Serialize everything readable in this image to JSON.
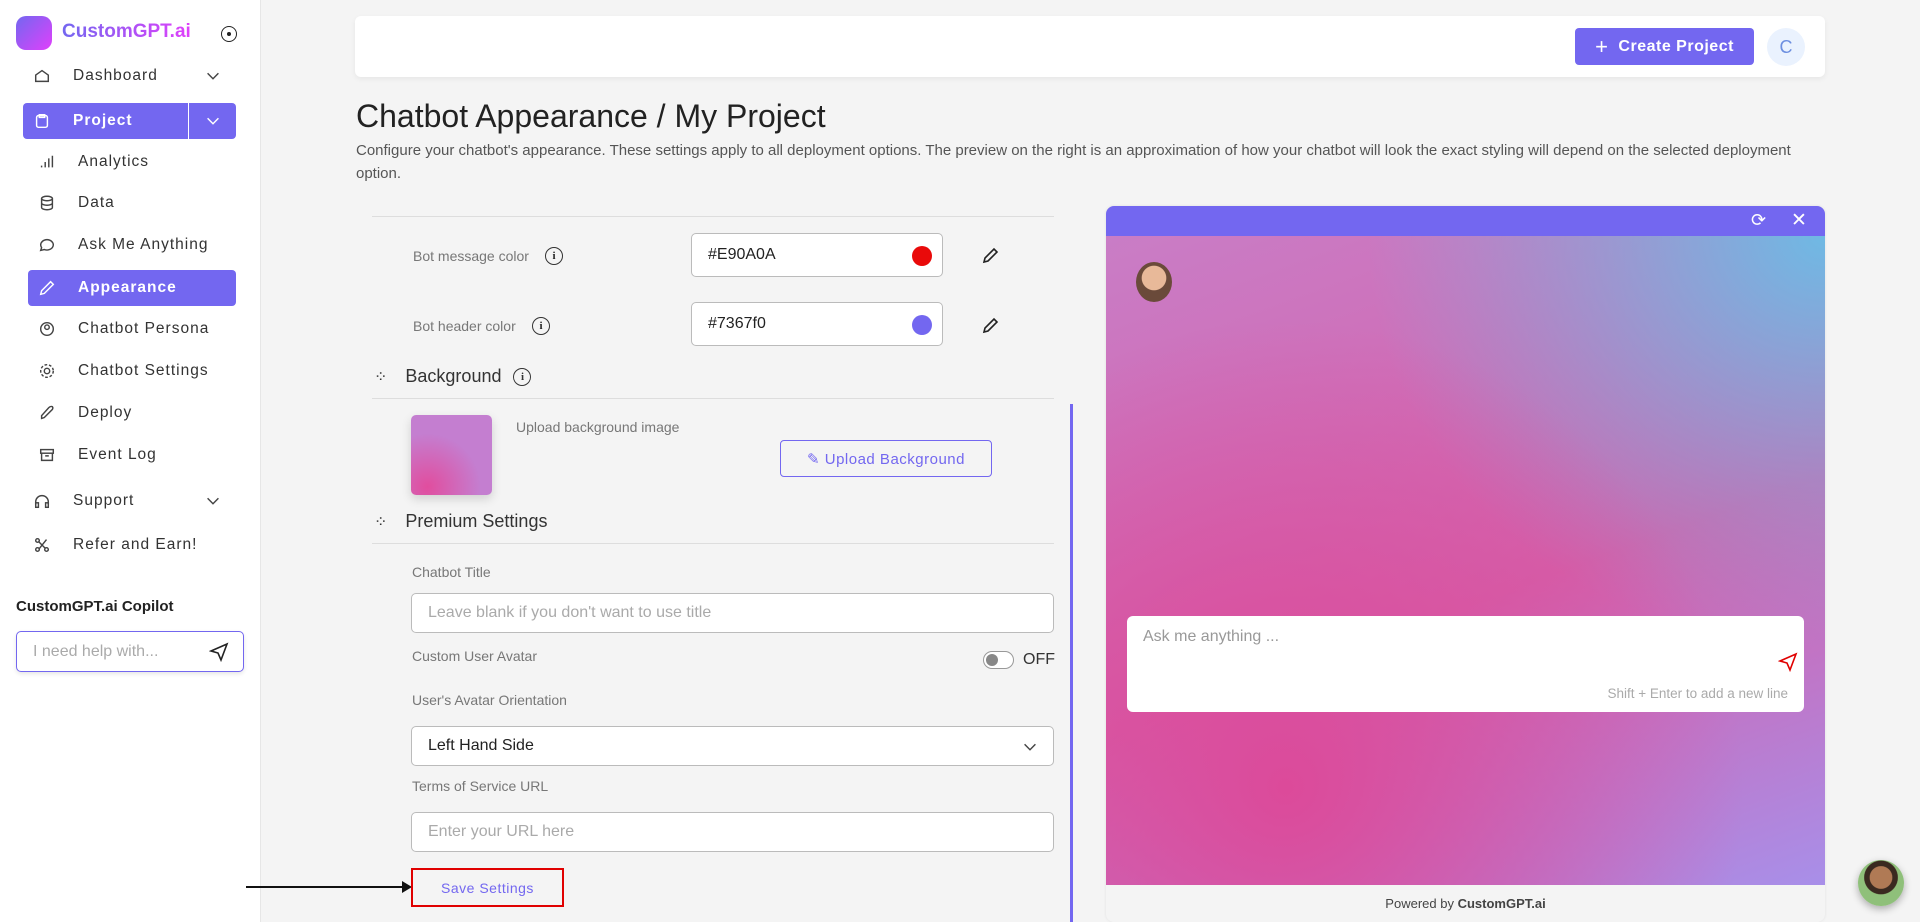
{
  "brand": {
    "name": "CustomGPT.ai"
  },
  "sidebar": {
    "items": [
      {
        "label": "Dashboard",
        "icon": "home-icon"
      },
      {
        "label": "Project",
        "icon": "clipboard-icon"
      },
      {
        "label": "Analytics",
        "icon": "bar-chart-icon"
      },
      {
        "label": "Data",
        "icon": "database-icon"
      },
      {
        "label": "Ask Me Anything",
        "icon": "chat-icon"
      },
      {
        "label": "Appearance",
        "icon": "brush-icon"
      },
      {
        "label": "Chatbot Persona",
        "icon": "user-circle-icon"
      },
      {
        "label": "Chatbot Settings",
        "icon": "gear-icon"
      },
      {
        "label": "Deploy",
        "icon": "rocket-icon"
      },
      {
        "label": "Event Log",
        "icon": "archive-icon"
      },
      {
        "label": "Support",
        "icon": "headphones-icon"
      },
      {
        "label": "Refer and Earn!",
        "icon": "share-icon"
      }
    ],
    "copilot": {
      "title": "CustomGPT.ai Copilot",
      "placeholder": "I need help with..."
    }
  },
  "header": {
    "create_label": "Create Project",
    "avatar_initial": "C"
  },
  "page": {
    "title": "Chatbot Appearance / My Project",
    "description": "Configure your chatbot's appearance. These settings apply to all deployment options. The preview on the right is an approximation of how your chatbot will look the exact styling will depend on the selected deployment option."
  },
  "form": {
    "bot_message_color": {
      "label": "Bot message color",
      "value": "#E90A0A"
    },
    "bot_header_color": {
      "label": "Bot header color",
      "value": "#7367f0"
    },
    "background": {
      "heading": "Background",
      "upload_text": "Upload background image",
      "upload_button": "Upload Background"
    },
    "premium": {
      "heading": "Premium Settings",
      "title_label": "Chatbot Title",
      "title_placeholder": "Leave blank if you don't want to use title",
      "avatar_label": "Custom User Avatar",
      "avatar_toggle": "OFF",
      "orientation_label": "User's Avatar Orientation",
      "orientation_value": "Left Hand Side",
      "tos_label": "Terms of Service URL",
      "tos_placeholder": "Enter your URL here"
    },
    "save_label": "Save Settings"
  },
  "preview": {
    "input_placeholder": "Ask me anything ...",
    "hint": "Shift + Enter to add a new line",
    "powered_prefix": "Powered by",
    "powered_brand": "CustomGPT.ai"
  },
  "colors": {
    "accent": "#7367f0",
    "bot_message": "#E90A0A",
    "highlight": "#e00000"
  }
}
